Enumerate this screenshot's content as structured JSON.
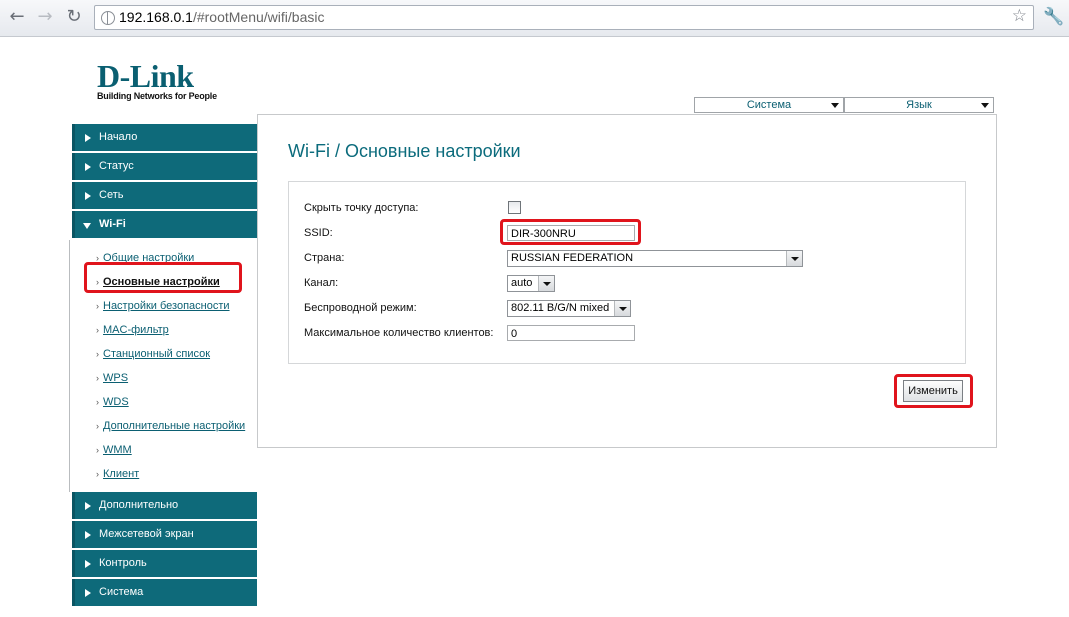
{
  "browser": {
    "back_icon": "arrow-left-icon",
    "forward_icon": "arrow-right-icon",
    "reload_icon": "reload-icon",
    "url_host": "192.168.0.1",
    "url_path": "/#rootMenu/wifi/basic",
    "star_icon": "star-icon",
    "wrench_icon": "wrench-icon"
  },
  "logo": {
    "brand": "D-Link",
    "tagline": "Building Networks for People"
  },
  "top_menu": {
    "system": "Система",
    "language": "Язык"
  },
  "sidebar": {
    "sections_top": [
      {
        "label": "Начало"
      },
      {
        "label": "Статус"
      },
      {
        "label": "Сеть"
      },
      {
        "label": "Wi-Fi"
      }
    ],
    "wifi_items": [
      {
        "label": "Общие настройки"
      },
      {
        "label": "Основные настройки"
      },
      {
        "label": "Настройки безопасности"
      },
      {
        "label": "MAC-фильтр"
      },
      {
        "label": "Станционный список"
      },
      {
        "label": "WPS"
      },
      {
        "label": "WDS"
      },
      {
        "label": "Дополнительные настройки"
      },
      {
        "label": "WMM"
      },
      {
        "label": "Клиент"
      }
    ],
    "sections_bottom": [
      {
        "label": "Дополнительно"
      },
      {
        "label": "Межсетевой экран"
      },
      {
        "label": "Контроль"
      },
      {
        "label": "Система"
      }
    ]
  },
  "main": {
    "title": "Wi-Fi  / Основные настройки",
    "form": {
      "hide_ap_label": "Скрыть точку доступа:",
      "hide_ap_checked": false,
      "ssid_label": "SSID:",
      "ssid_value": "DIR-300NRU",
      "country_label": "Страна:",
      "country_value": "RUSSIAN FEDERATION",
      "channel_label": "Канал:",
      "channel_value": "auto",
      "mode_label": "Беспроводной режим:",
      "mode_value": "802.11 B/G/N mixed",
      "max_clients_label": "Максимальное количество клиентов:",
      "max_clients_value": "0"
    },
    "apply_label": "Изменить"
  },
  "colors": {
    "accent": "#0e6a7a",
    "highlight": "#e0141c"
  }
}
